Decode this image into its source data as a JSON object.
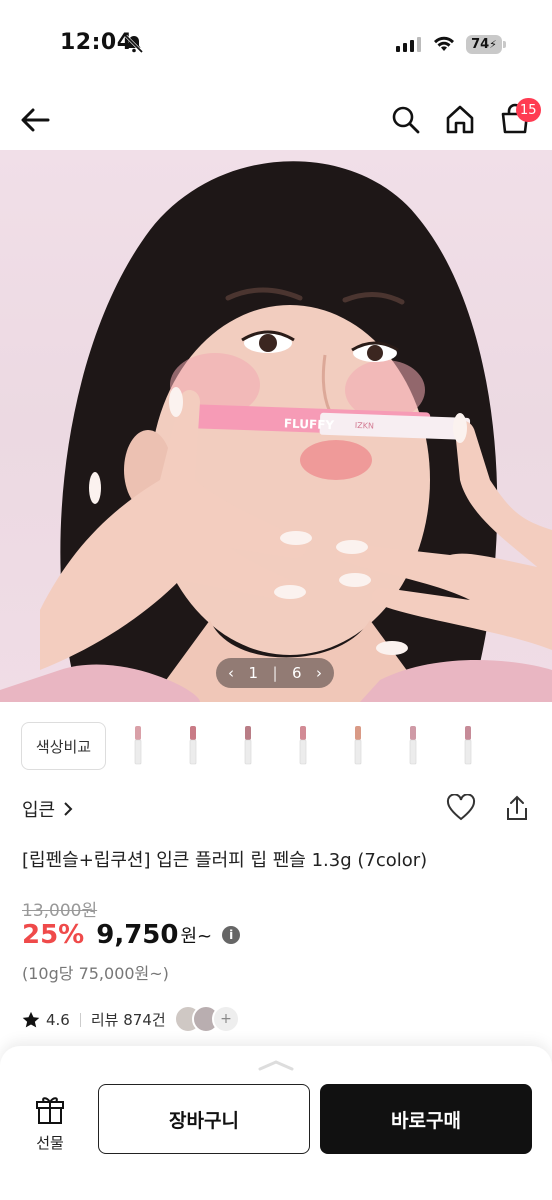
{
  "status": {
    "time": "12:04",
    "battery": "74"
  },
  "header": {
    "cart_count": "15"
  },
  "gallery": {
    "current": "1",
    "total": "6",
    "pen_brand": "FLUFFY",
    "pen_maker": "IZKN"
  },
  "colors": {
    "compare_label": "색상비교",
    "swatches": [
      "#d9a0a8",
      "#c97b86",
      "#b97d86",
      "#d28b95",
      "#d99a86",
      "#cf9aa6",
      "#c68b98"
    ]
  },
  "product": {
    "brand": "입큰",
    "title": "[립펜슬+립쿠션] 입큰 플러피 립 펜슬 1.3g (7color)",
    "original_price": "13,000원",
    "discount": "25%",
    "sale_price": "9,750",
    "sale_suffix": "원~",
    "unit_price": "(10g당 75,000원~)",
    "rating": "4.6",
    "reviews": "리뷰 874건"
  },
  "bottom_bar": {
    "gift_label": "선물",
    "cart_button": "장바구니",
    "buy_button": "바로구매"
  }
}
